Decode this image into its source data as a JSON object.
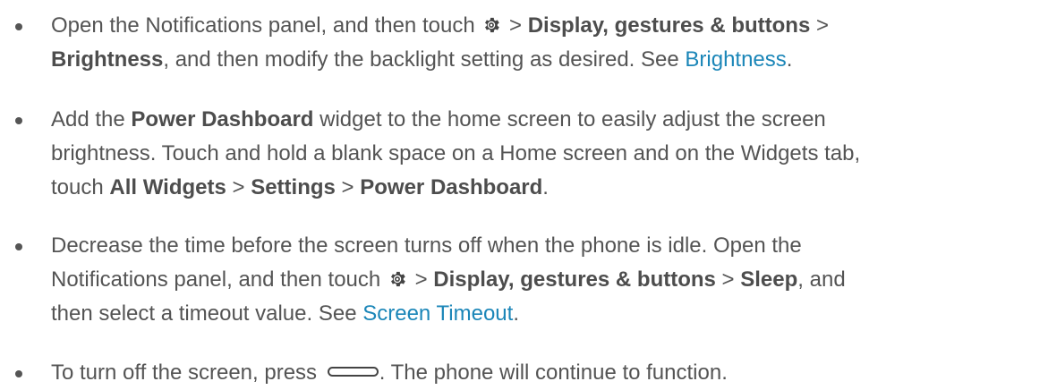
{
  "tips": [
    {
      "lines": [
        [
          {
            "t": "Open the Notifications panel, and then touch "
          },
          {
            "icon": "gear-icon"
          },
          {
            "t": " > "
          },
          {
            "t": "Display, gestures & buttons",
            "b": true
          },
          {
            "t": " >"
          }
        ],
        [
          {
            "t": "Brightness",
            "b": true
          },
          {
            "t": ", and then modify the backlight setting as desired. See "
          },
          {
            "t": "Brightness",
            "link": true
          },
          {
            "t": "."
          }
        ]
      ]
    },
    {
      "lines": [
        [
          {
            "t": "Add the "
          },
          {
            "t": "Power Dashboard",
            "b": true
          },
          {
            "t": " widget to the home screen to easily adjust the screen"
          }
        ],
        [
          {
            "t": "brightness. Touch and hold a blank space on a Home screen and on the Widgets tab,"
          }
        ],
        [
          {
            "t": "touch "
          },
          {
            "t": "All Widgets",
            "b": true
          },
          {
            "t": " > "
          },
          {
            "t": "Settings",
            "b": true
          },
          {
            "t": " > "
          },
          {
            "t": "Power Dashboard",
            "b": true
          },
          {
            "t": "."
          }
        ]
      ]
    },
    {
      "lines": [
        [
          {
            "t": "Decrease the time before the screen turns off when the phone is idle. Open the"
          }
        ],
        [
          {
            "t": "Notifications panel, and then touch "
          },
          {
            "icon": "gear-icon"
          },
          {
            "t": " > "
          },
          {
            "t": "Display, gestures & buttons",
            "b": true
          },
          {
            "t": " > "
          },
          {
            "t": "Sleep",
            "b": true
          },
          {
            "t": ", and"
          }
        ],
        [
          {
            "t": "then select a timeout value. See "
          },
          {
            "t": "Screen Timeout",
            "link": true
          },
          {
            "t": "."
          }
        ]
      ]
    },
    {
      "lines": [
        [
          {
            "t": "To turn off the screen, press "
          },
          {
            "icon": "power-key-icon"
          },
          {
            "t": ". The phone will continue to function."
          }
        ]
      ]
    }
  ]
}
